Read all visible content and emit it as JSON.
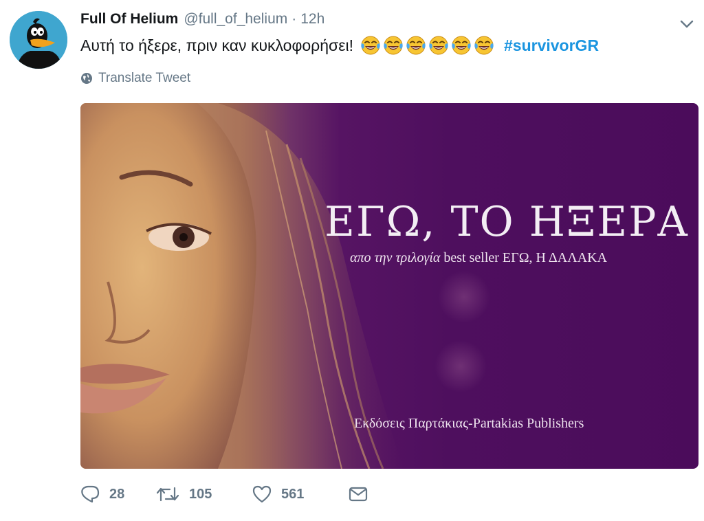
{
  "tweet": {
    "author_name": "Full Of Helium",
    "handle": "@full_of_helium",
    "separator": "·",
    "time": "12h",
    "text": "Αυτή το ήξερε, πριν καν κυκλοφορήσει!",
    "emoji_count": 6,
    "hashtag": "#survivorGR",
    "translate_label": "Translate Tweet"
  },
  "media": {
    "title": "ΕΓΩ, ΤΟ ΗΞΕΡΑ",
    "subtitle_italic": "απο την τριλογία",
    "subtitle_rest": " best seller ΕΓΩ, Η ΔΑΛΑΚΑ",
    "publisher": "Εκδόσεις Παρτάκιας-Partakias Publishers"
  },
  "actions": {
    "replies": "28",
    "retweets": "105",
    "likes": "561"
  },
  "colors": {
    "link": "#1b95e0",
    "secondary_text": "#657786",
    "cover_purple": "#4e0f5e"
  },
  "icons": {
    "avatar": "daffy-duck-avatar",
    "caret": "chevron-down-icon",
    "translate": "globe-icon",
    "reply": "reply-icon",
    "retweet": "retweet-icon",
    "like": "heart-icon",
    "message": "direct-message-icon",
    "emoji": "tears-of-joy-emoji"
  }
}
